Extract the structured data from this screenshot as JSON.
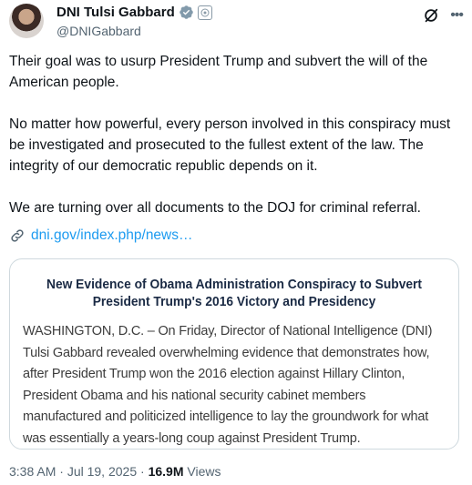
{
  "author": {
    "name": "DNI Tulsi Gabbard",
    "handle": "@DNIGabbard"
  },
  "icons": {
    "verified": "verified-badge-icon",
    "affiliation": "government-affiliation-icon",
    "grok": "grok-icon",
    "more": "more-options-icon",
    "link": "link-icon"
  },
  "colors": {
    "link": "#1d9bf0",
    "verified_badge": "#829aab",
    "muted": "#536471"
  },
  "tweet": {
    "paragraphs": [
      "Their goal was to usurp President Trump and subvert the will of the American people.",
      "No matter how powerful, every person involved in this conspiracy must be investigated and prosecuted to the fullest extent of the law. The integrity of our democratic republic depends on it.",
      "We are turning over all documents to the DOJ for criminal referral."
    ],
    "link_text": "dni.gov/index.php/news…"
  },
  "card": {
    "title": "New Evidence of Obama Administration Conspiracy to Subvert President Trump's 2016 Victory and Presidency",
    "body": "WASHINGTON, D.C. – On Friday, Director of National Intelligence (DNI) Tulsi Gabbard revealed overwhelming evidence that demonstrates how, after President Trump won the 2016 election against Hillary Clinton, President Obama and his national security cabinet members manufactured and politicized intelligence to lay the groundwork for what was essentially a years-long coup against President Trump."
  },
  "meta": {
    "time": "3:38 AM",
    "separator": " · ",
    "date": "Jul 19, 2025",
    "views_count": "16.9M",
    "views_label": " Views"
  }
}
